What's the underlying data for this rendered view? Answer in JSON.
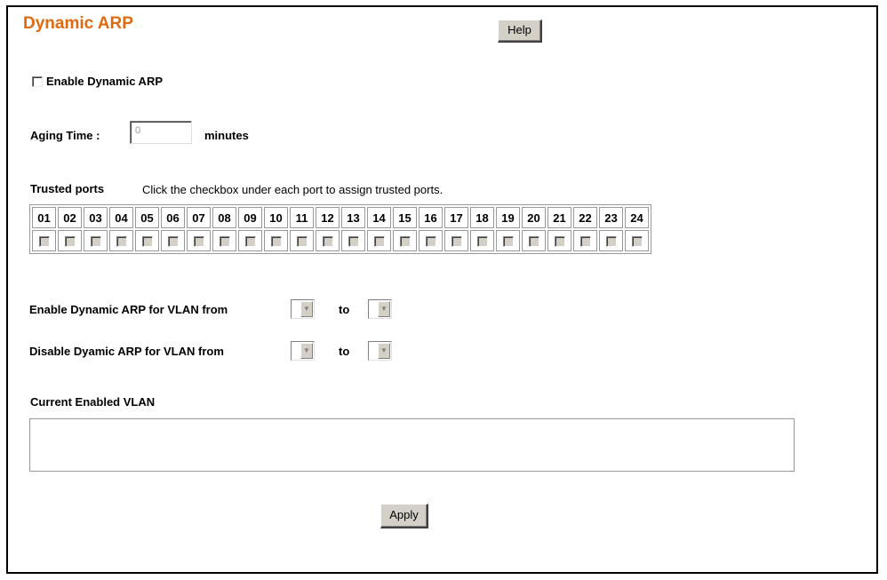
{
  "page": {
    "title": "Dynamic ARP",
    "help_label": "Help",
    "apply_label": "Apply"
  },
  "enable_dynamic_arp": {
    "label": "Enable Dynamic ARP",
    "checked": false
  },
  "aging_time": {
    "label": "Aging Time :",
    "value": "0",
    "unit": "minutes"
  },
  "trusted_ports": {
    "label": "Trusted ports",
    "hint": "Click the checkbox under each port to assign trusted ports.",
    "ports": [
      "01",
      "02",
      "03",
      "04",
      "05",
      "06",
      "07",
      "08",
      "09",
      "10",
      "11",
      "12",
      "13",
      "14",
      "15",
      "16",
      "17",
      "18",
      "19",
      "20",
      "21",
      "22",
      "23",
      "24"
    ]
  },
  "vlan_enable": {
    "label": "Enable Dynamic ARP for VLAN from",
    "to_label": "to",
    "from_value": "",
    "to_value": ""
  },
  "vlan_disable": {
    "label": "Disable Dyamic ARP for VLAN from",
    "to_label": "to",
    "from_value": "",
    "to_value": ""
  },
  "current_enabled_vlan": {
    "label": "Current Enabled VLAN",
    "value": ""
  },
  "colors": {
    "title": "#e06a10",
    "button_face": "#d4d0c8",
    "border": "#999999"
  }
}
